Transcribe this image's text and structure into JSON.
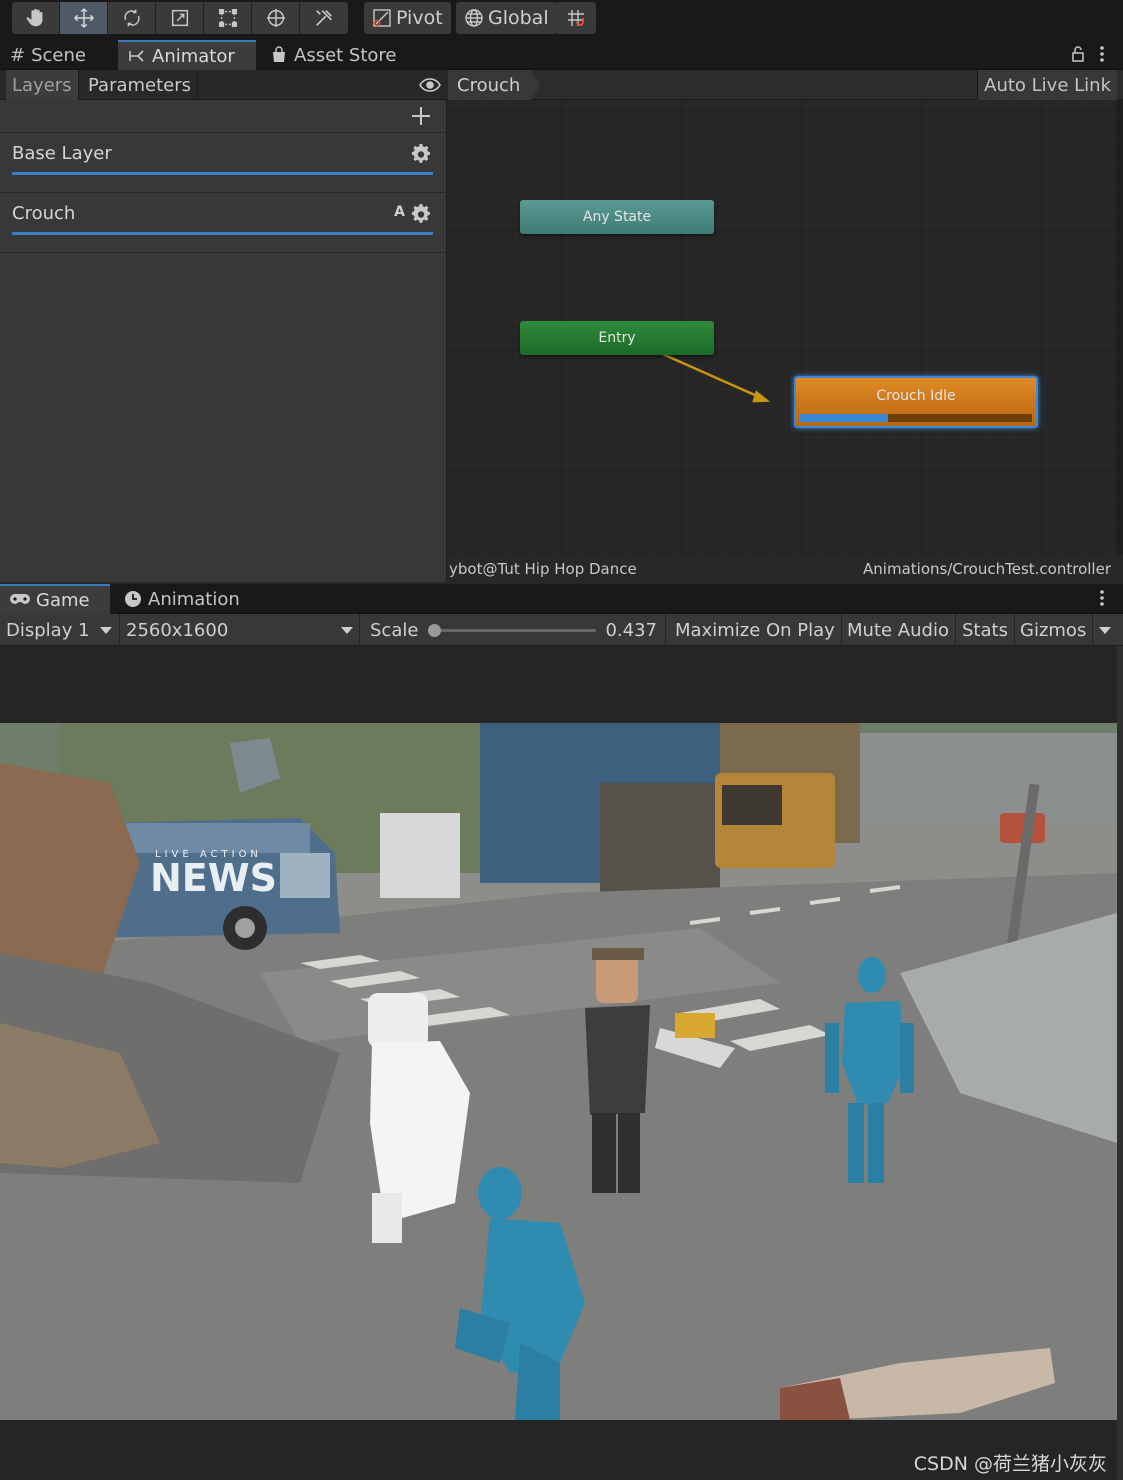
{
  "toolbar": {
    "tools": [
      "hand-tool",
      "move-tool",
      "rotate-tool",
      "scale-tool",
      "rect-tool",
      "transform-tool",
      "custom-tool"
    ],
    "pivot_label": "Pivot",
    "global_label": "Global"
  },
  "top_tabs": {
    "scene": "Scene",
    "animator": "Animator",
    "asset_store": "Asset Store"
  },
  "animator": {
    "subtabs": {
      "layers": "Layers",
      "parameters": "Parameters"
    },
    "layers": [
      {
        "name": "Base Layer"
      },
      {
        "name": "Crouch",
        "badge": "A"
      }
    ],
    "breadcrumb": "Crouch",
    "auto_live_link": "Auto Live Link",
    "states": {
      "any_state": "Any State",
      "entry": "Entry",
      "crouch_idle": "Crouch Idle"
    },
    "crouch_idle_progress": 0.38,
    "footer_left": "ybot@Tut Hip Hop Dance",
    "footer_right": "Animations/CrouchTest.controller"
  },
  "bottom_tabs": {
    "game": "Game",
    "animation": "Animation"
  },
  "game_toolbar": {
    "display": "Display 1",
    "resolution": "2560x1600",
    "scale_label": "Scale",
    "scale_value": "0.437",
    "scale_fraction": 0.0,
    "maximize_on_play": "Maximize On Play",
    "mute_audio": "Mute Audio",
    "stats": "Stats",
    "gizmos": "Gizmos"
  },
  "scene_text": {
    "van_small": "LIVE ACTION",
    "van_big": "NEWS"
  },
  "watermark": "CSDN @荷兰猪小灰灰",
  "colors": {
    "accent_blue": "#3b7ec9",
    "any_state": "#4f8f89",
    "entry": "#258030",
    "crouch_idle": "#d07c1c"
  }
}
